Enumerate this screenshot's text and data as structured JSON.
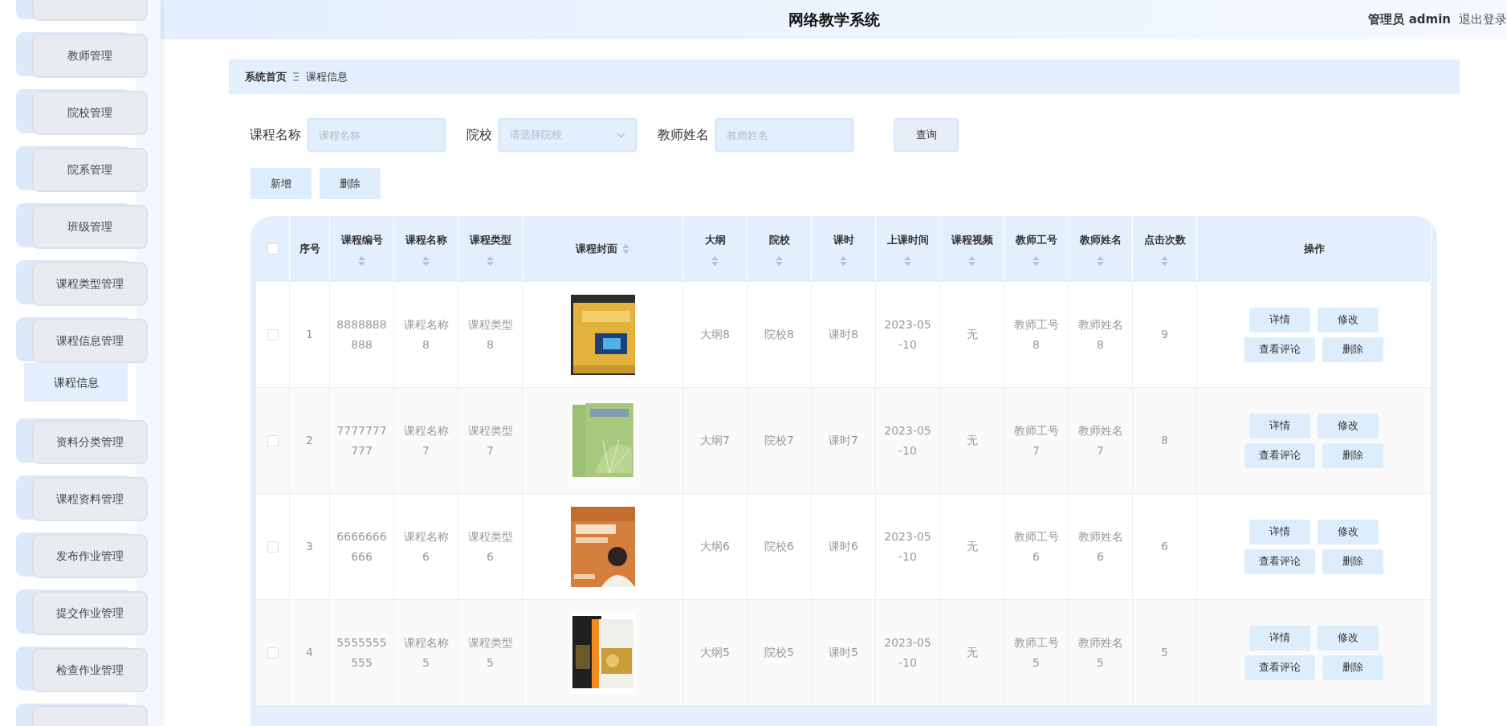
{
  "sidebar": {
    "items": [
      {
        "kind": "cut"
      },
      {
        "kind": "menu",
        "label": "教师管理"
      },
      {
        "kind": "menu",
        "label": "院校管理"
      },
      {
        "kind": "menu",
        "label": "院系管理"
      },
      {
        "kind": "menu",
        "label": "班级管理"
      },
      {
        "kind": "menu",
        "label": "课程类型管理"
      },
      {
        "kind": "menu",
        "label": "课程信息管理",
        "children": [
          {
            "label": "课程信息",
            "selected": true
          }
        ]
      },
      {
        "kind": "menu",
        "label": "资料分类管理"
      },
      {
        "kind": "menu",
        "label": "课程资料管理"
      },
      {
        "kind": "menu",
        "label": "发布作业管理"
      },
      {
        "kind": "menu",
        "label": "提交作业管理"
      },
      {
        "kind": "menu",
        "label": "检查作业管理"
      },
      {
        "kind": "cut"
      }
    ]
  },
  "header": {
    "title": "网络教学系统",
    "user": "管理员 admin",
    "logout": "退出登录"
  },
  "breadcrumb": [
    "系统首页",
    "课程信息"
  ],
  "search": {
    "fields": [
      {
        "kind": "input",
        "label": "课程名称",
        "placeholder": "课程名称"
      },
      {
        "kind": "select",
        "label": "院校",
        "placeholder": "请选择院校"
      },
      {
        "kind": "input",
        "label": "教师姓名",
        "placeholder": "教师姓名"
      }
    ],
    "button": "查询"
  },
  "toolbar": [
    "新增",
    "删除"
  ],
  "table": {
    "all_checked": false,
    "columns": [
      {
        "kind": "checkbox"
      },
      {
        "kind": "text",
        "label": "序号",
        "sortable": false
      },
      {
        "kind": "text",
        "label": "课程编号",
        "sortable": true
      },
      {
        "kind": "text",
        "label": "课程名称",
        "sortable": true
      },
      {
        "kind": "text",
        "label": "课程类型",
        "sortable": true
      },
      {
        "kind": "picture",
        "label": "课程封面",
        "sortable": true
      },
      {
        "kind": "text",
        "label": "大纲",
        "sortable": true
      },
      {
        "kind": "text",
        "label": "院校",
        "sortable": true
      },
      {
        "kind": "text",
        "label": "课时",
        "sortable": true
      },
      {
        "kind": "text",
        "label": "上课时间",
        "sortable": true
      },
      {
        "kind": "text",
        "label": "课程视频",
        "sortable": true
      },
      {
        "kind": "text",
        "label": "教师工号",
        "sortable": true
      },
      {
        "kind": "text",
        "label": "教师姓名",
        "sortable": true
      },
      {
        "kind": "text",
        "label": "点击次数",
        "sortable": true
      },
      {
        "kind": "actions",
        "label": "操作",
        "sortable": false
      }
    ],
    "rows": [
      {
        "checked": false,
        "values": [
          "1",
          "8888888888",
          "课程名称8",
          "课程类型8",
          "大纲8",
          "院校8",
          "课时8",
          "2023-05-10",
          "无",
          "教师工号8",
          "教师姓名8",
          "9"
        ],
        "cover": {
          "kind": "picture"
        },
        "actions": [
          "详情",
          "修改",
          "查看评论",
          "删除"
        ]
      },
      {
        "checked": false,
        "values": [
          "2",
          "7777777777",
          "课程名称7",
          "课程类型7",
          "大纲7",
          "院校7",
          "课时7",
          "2023-05-10",
          "无",
          "教师工号7",
          "教师姓名7",
          "8"
        ],
        "cover": {
          "kind": "picture"
        },
        "actions": [
          "详情",
          "修改",
          "查看评论",
          "删除"
        ]
      },
      {
        "checked": false,
        "values": [
          "3",
          "6666666666",
          "课程名称6",
          "课程类型6",
          "大纲6",
          "院校6",
          "课时6",
          "2023-05-10",
          "无",
          "教师工号6",
          "教师姓名6",
          "6"
        ],
        "cover": {
          "kind": "picture"
        },
        "actions": [
          "详情",
          "修改",
          "查看评论",
          "删除"
        ]
      },
      {
        "checked": false,
        "values": [
          "4",
          "5555555555",
          "课程名称5",
          "课程类型5",
          "大纲5",
          "院校5",
          "课时5",
          "2023-05-10",
          "无",
          "教师工号5",
          "教师姓名5",
          "5"
        ],
        "cover": {
          "kind": "picture"
        },
        "actions": [
          "详情",
          "修改",
          "查看评论",
          "删除"
        ]
      }
    ]
  }
}
